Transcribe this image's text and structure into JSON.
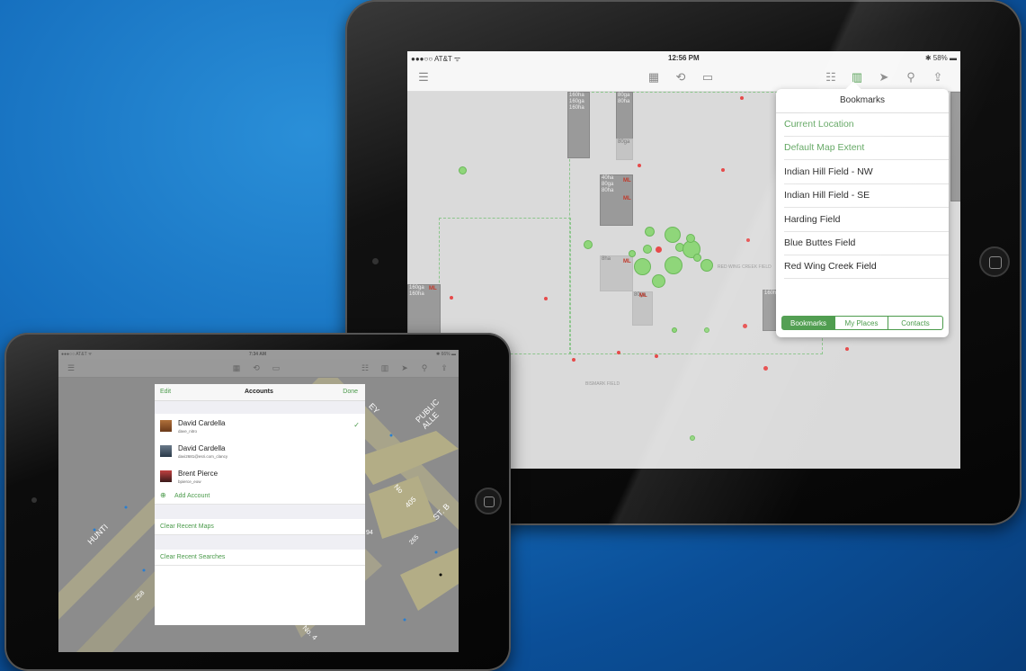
{
  "large": {
    "status": {
      "left": "●●●○○ AT&T ᯤ",
      "time": "12:56 PM",
      "right": "✱ 58% ▬"
    },
    "bookmarks": {
      "title": "Bookmarks",
      "items": [
        {
          "label": "Current Location",
          "color": "#5ba35b"
        },
        {
          "label": "Default Map Extent",
          "color": "#5ba35b"
        },
        {
          "label": "Indian Hill Field - NW",
          "color": "#222222"
        },
        {
          "label": "Indian Hill Field - SE",
          "color": "#222222"
        },
        {
          "label": "Harding Field",
          "color": "#222222"
        },
        {
          "label": "Blue Buttes Field",
          "color": "#222222"
        },
        {
          "label": "Red Wing Creek Field",
          "color": "#222222"
        }
      ],
      "segments": [
        "Bookmarks",
        "My Places",
        "Contacts"
      ],
      "active_segment": "Bookmarks"
    },
    "map_labels": {
      "p1": "160ha\n160ga\n160ha",
      "p2": "80ga\n80ha",
      "p3": "160ga",
      "p4": "80ga",
      "p5": "40ha\n80ga\n80ha",
      "p6": "160ga",
      "p7": "8ha",
      "p8": "160ga",
      "p9": "80ga",
      "p10": "160ha",
      "p11": "160ga\n160ha",
      "p12": "160ha",
      "p13": "160ga",
      "p14": "160ga",
      "ml": "ML",
      "field1": "RED WING CREEK FIELD",
      "field2": "BISMARK FIELD"
    }
  },
  "small": {
    "status": {
      "left": "●●●○○ AT&T ᯤ",
      "time": "7:34 AM",
      "right": "✱ 66% ▬"
    },
    "accounts": {
      "edit": "Edit",
      "title": "Accounts",
      "done": "Done",
      "users": [
        {
          "name": "David Cardella",
          "sub": "dave_nitro",
          "checked": true
        },
        {
          "name": "David Cardella",
          "sub": "davi2681@esri.com_clancy",
          "checked": false
        },
        {
          "name": "Brent Pierce",
          "sub": "bpierce_eow",
          "checked": false
        }
      ],
      "add": "Add Account",
      "clear_maps": "Clear Recent Maps",
      "clear_searches": "Clear Recent Searches"
    },
    "street_labels": {
      "s1": "HUNTI",
      "s2": "PUBLIC ALLE",
      "s3": "EY",
      "s4": "ST. B",
      "s5": "405",
      "s6": "No",
      "s7": "265",
      "s8": "258",
      "s9": "No. 4",
      "s10": "94"
    }
  }
}
